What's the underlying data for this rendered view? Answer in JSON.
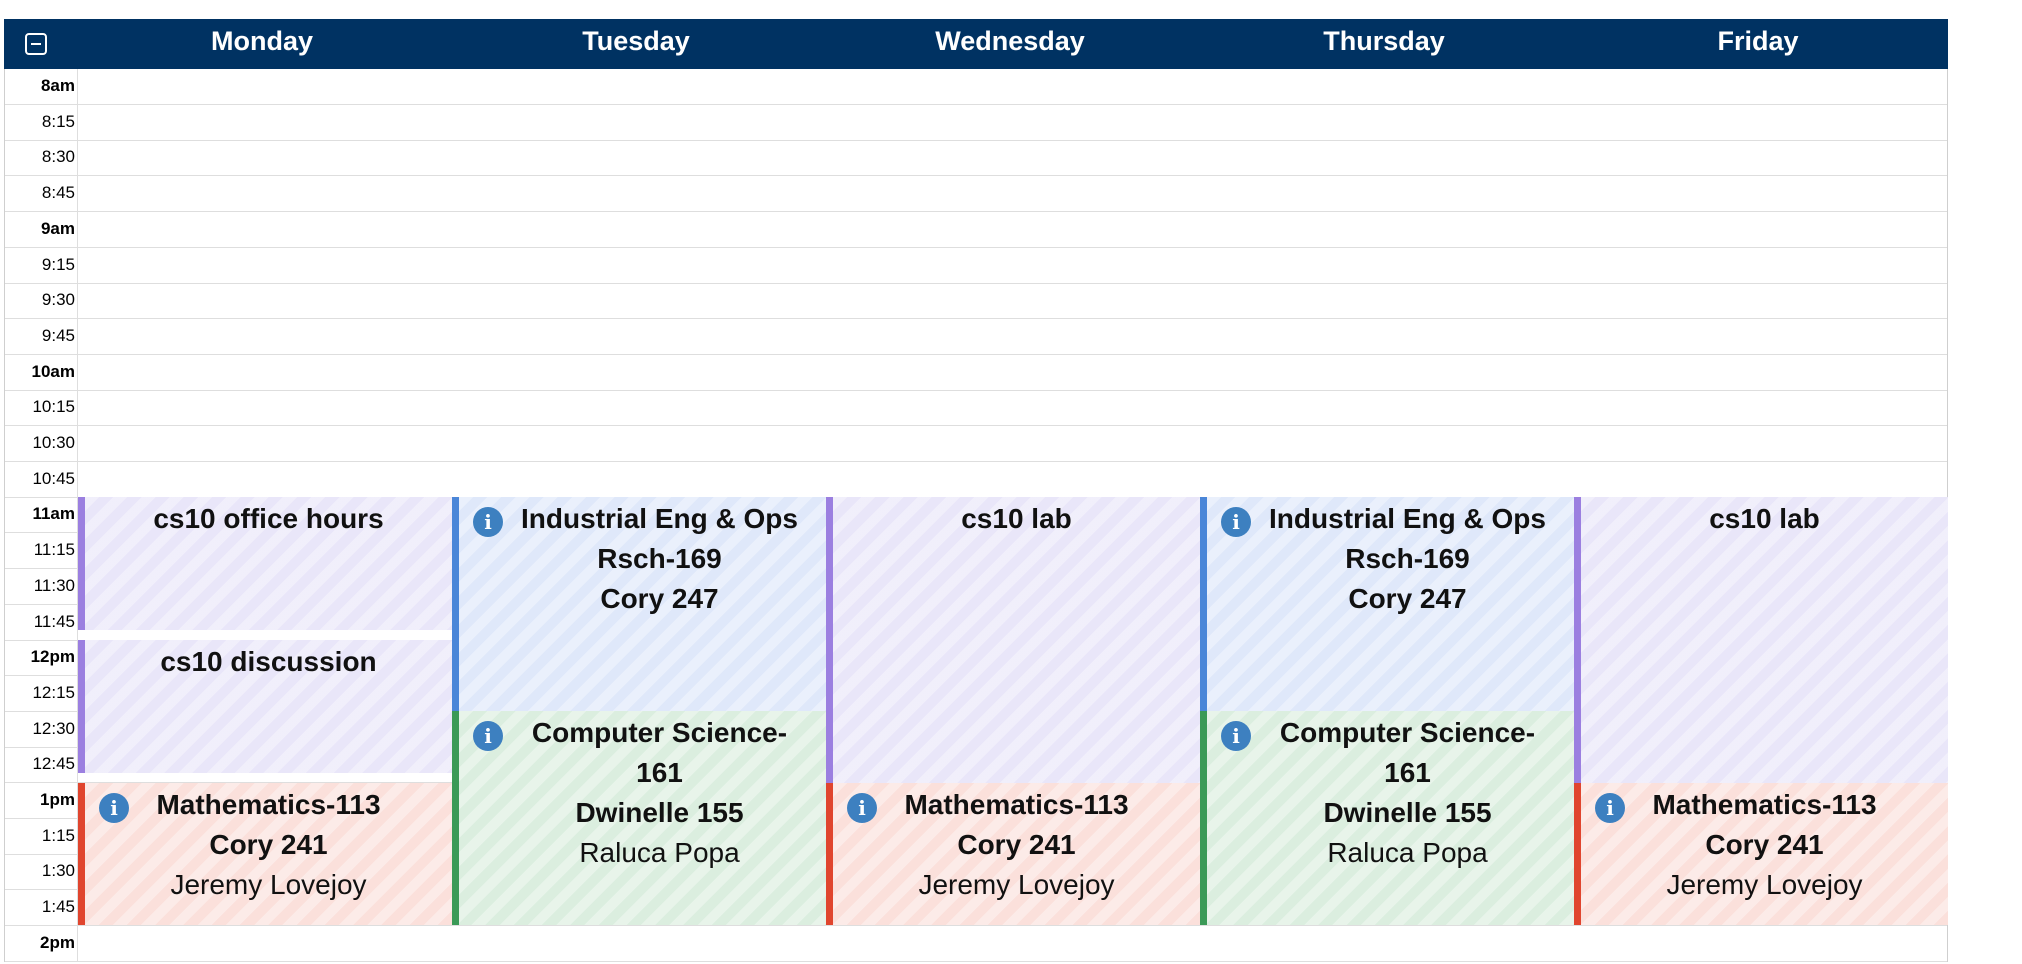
{
  "days": [
    "Monday",
    "Tuesday",
    "Wednesday",
    "Thursday",
    "Friday"
  ],
  "times": [
    "8am",
    "8:15",
    "8:30",
    "8:45",
    "9am",
    "9:15",
    "9:30",
    "9:45",
    "10am",
    "10:15",
    "10:30",
    "10:45",
    "11am",
    "11:15",
    "11:30",
    "11:45",
    "12pm",
    "12:15",
    "12:30",
    "12:45",
    "1pm",
    "1:15",
    "1:30",
    "1:45",
    "2pm"
  ],
  "colors": {
    "header": "#003262",
    "purple": "#9b7fe0",
    "blue": "#4a86d8",
    "green": "#3b9a57",
    "red": "#e0452e",
    "info": "#3d80c0"
  },
  "icons": {
    "collapse": "minus-square-icon",
    "info": "info-circle-icon"
  },
  "events": {
    "mon_office": {
      "title": "cs10 office hours"
    },
    "mon_disc": {
      "title": "cs10 discussion"
    },
    "mon_math": {
      "title": "Mathematics-113",
      "location": "Cory 241",
      "instructor": "Jeremy Lovejoy"
    },
    "tue_ieor": {
      "title": "Industrial Eng & Ops Rsch-169",
      "location": "Cory 247"
    },
    "tue_cs": {
      "title": "Computer Science-161",
      "location": "Dwinelle 155",
      "instructor": "Raluca Popa"
    },
    "wed_lab": {
      "title": "cs10 lab"
    },
    "wed_math": {
      "title": "Mathematics-113",
      "location": "Cory 241",
      "instructor": "Jeremy Lovejoy"
    },
    "thu_ieor": {
      "title": "Industrial Eng & Ops Rsch-169",
      "location": "Cory 247"
    },
    "thu_cs": {
      "title": "Computer Science-161",
      "location": "Dwinelle 155",
      "instructor": "Raluca Popa"
    },
    "fri_lab": {
      "title": "cs10 lab"
    },
    "fri_math": {
      "title": "Mathematics-113",
      "location": "Cory 241",
      "instructor": "Jeremy Lovejoy"
    }
  }
}
